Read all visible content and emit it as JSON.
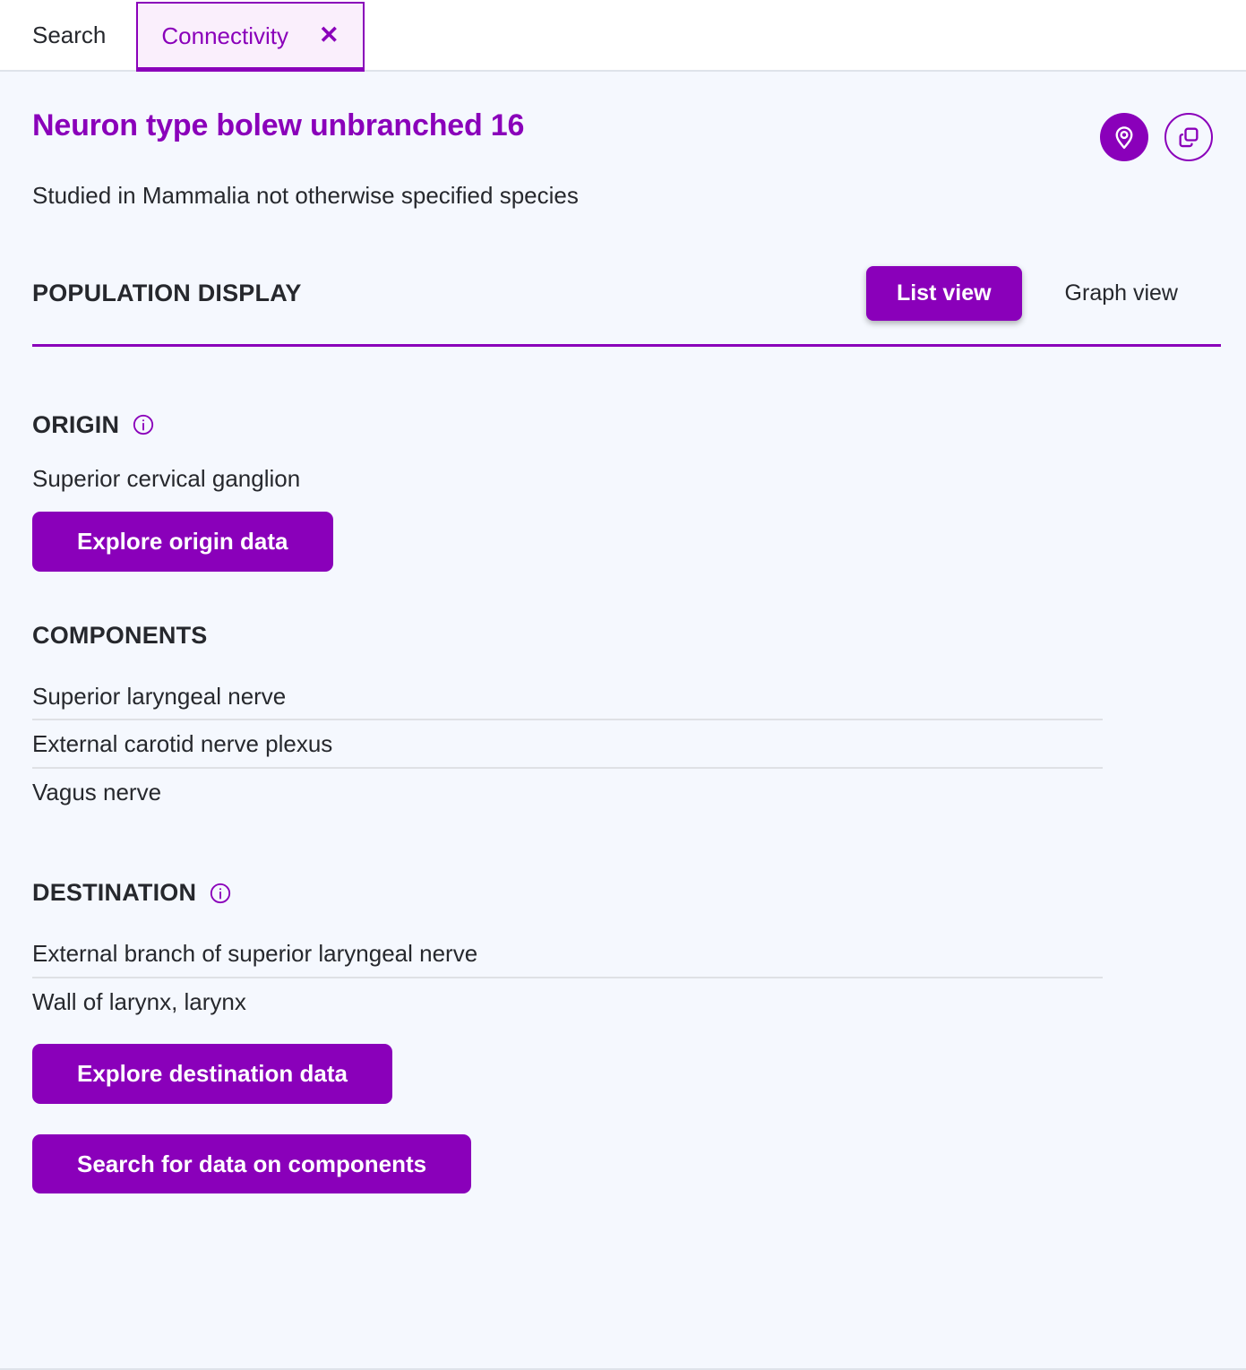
{
  "tabs": [
    {
      "label": "Search",
      "active": false,
      "closable": false
    },
    {
      "label": "Connectivity",
      "active": true,
      "closable": true,
      "close_glyph": "✕"
    }
  ],
  "header": {
    "title": "Neuron type bolew unbranched 16",
    "subtitle": "Studied in Mammalia not otherwise specified species",
    "icons": [
      {
        "name": "map-pin-icon",
        "style": "filled"
      },
      {
        "name": "copy-layers-icon",
        "style": "outlined"
      }
    ]
  },
  "population_display": {
    "label": "POPULATION DISPLAY",
    "views": [
      {
        "label": "List view",
        "active": true
      },
      {
        "label": "Graph view",
        "active": false
      }
    ]
  },
  "origin": {
    "heading": "ORIGIN",
    "info_glyph": "i",
    "value": "Superior cervical ganglion",
    "button": "Explore origin data"
  },
  "components": {
    "heading": "COMPONENTS",
    "items": [
      "Superior laryngeal nerve",
      "External carotid nerve plexus",
      "Vagus nerve"
    ]
  },
  "destination": {
    "heading": "DESTINATION",
    "info_glyph": "i",
    "items": [
      "External branch of superior laryngeal nerve",
      "Wall of larynx, larynx"
    ],
    "button": "Explore destination data"
  },
  "actions": {
    "search_components": "Search for data on components"
  },
  "colors": {
    "accent": "#8A00BA",
    "accent_tab_bg": "#FAEFFC",
    "page_bg": "#F5F8FE",
    "text": "#26282D",
    "divider": "#DFE1E5"
  }
}
